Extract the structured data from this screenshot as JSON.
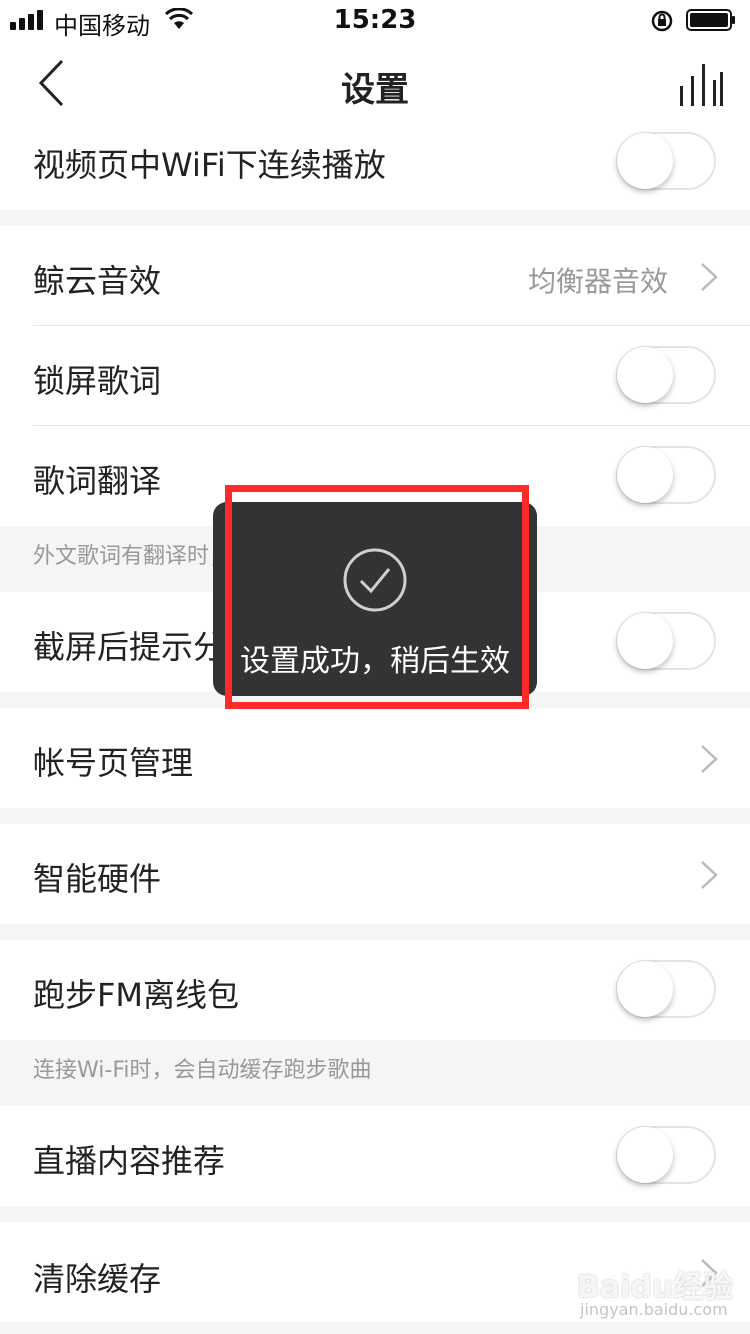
{
  "status": {
    "carrier": "中国移动",
    "time": "15:23"
  },
  "nav": {
    "title": "设置"
  },
  "rows": {
    "wifi_autoplay": "视频页中WiFi下连续播放",
    "sound_effect": "鲸云音效",
    "sound_effect_value": "均衡器音效",
    "lock_lyrics": "锁屏歌词",
    "lyrics_translate": "歌词翻译",
    "lyrics_translate_note": "外文歌词有翻译时，允许显示中文翻译",
    "screenshot_share": "截屏后提示分享",
    "account_manage": "帐号页管理",
    "smart_hardware": "智能硬件",
    "running_fm": "跑步FM离线包",
    "running_fm_note": "连接Wi-Fi时，会自动缓存跑步歌曲",
    "live_recommend": "直播内容推荐",
    "clear_cache": "清除缓存"
  },
  "toast": {
    "message": "设置成功，稍后生效"
  },
  "watermark": {
    "brand": "Baidu经验",
    "url": "jingyan.baidu.com"
  }
}
